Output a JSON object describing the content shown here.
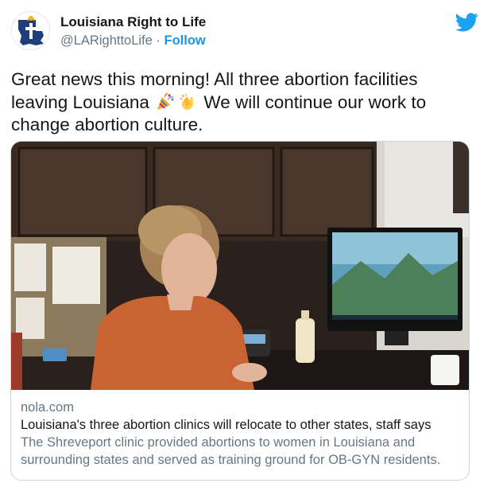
{
  "author": {
    "name": "Louisiana Right to Life",
    "handle": "@LARighttoLife",
    "separator": " · ",
    "follow_label": "Follow"
  },
  "tweet": {
    "text_1": "Great news this morning! All three abortion facilities leaving Louisiana",
    "text_2": "We will continue our work to change abortion culture."
  },
  "icons": {
    "twitter_logo": "twitter-bird",
    "emoji_1": "party-popper",
    "emoji_2": "clapping-hands",
    "avatar": "louisiana-state-logo"
  },
  "colors": {
    "link_blue": "#1b95e0",
    "twitter_blue": "#1da1f2",
    "secondary_text": "#657786"
  },
  "card": {
    "domain": "nola.com",
    "title": "Louisiana's three abortion clinics will relocate to other states, staff says",
    "description": "The Shreveport clinic provided abortions to women in Louisiana and surrounding states and served as training ground for OB-GYN residents."
  }
}
